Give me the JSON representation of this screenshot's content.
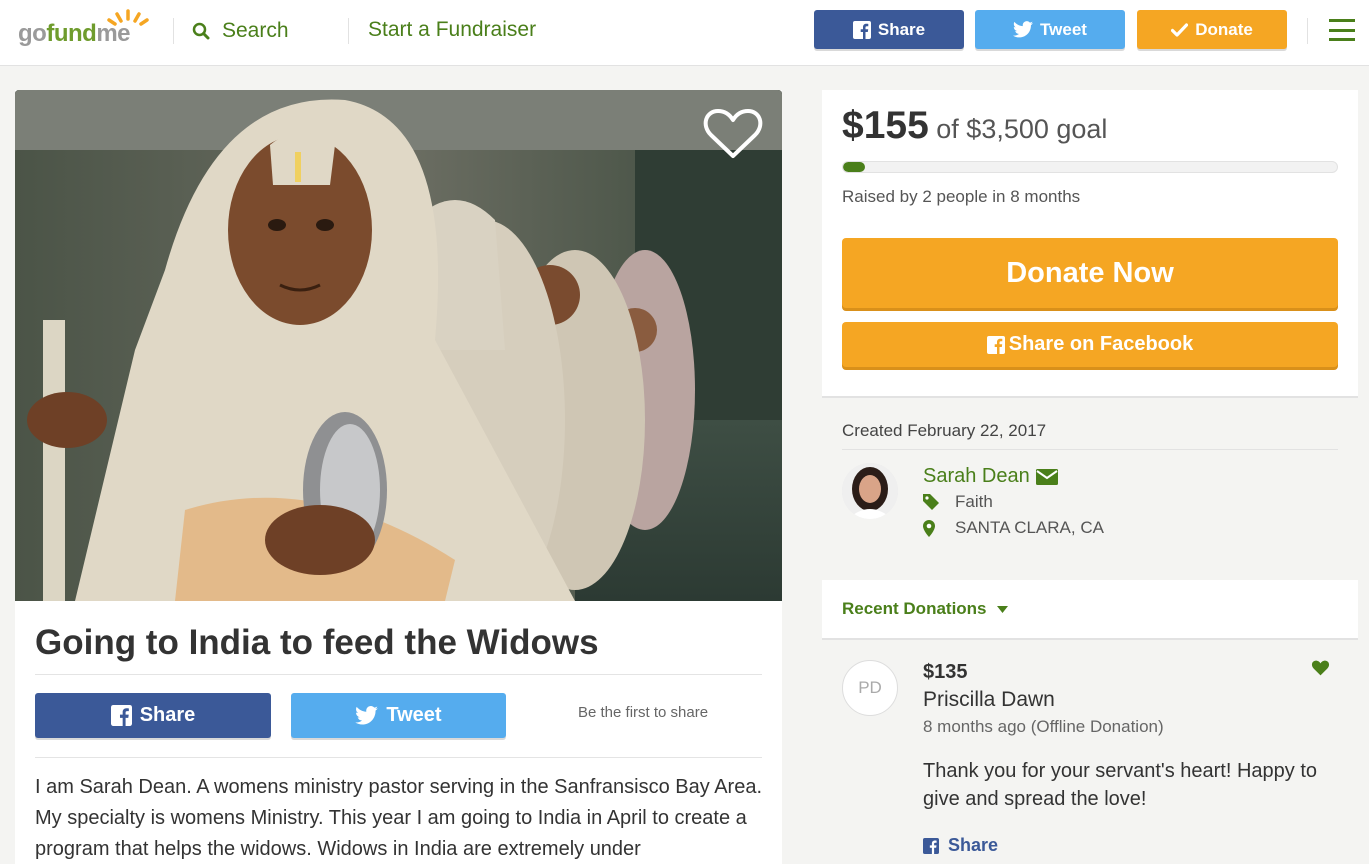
{
  "header": {
    "logo": "gofundme",
    "search_label": "Search",
    "start_label": "Start a Fundraiser",
    "share_label": "Share",
    "tweet_label": "Tweet",
    "donate_label": "Donate"
  },
  "campaign": {
    "title": "Going to India to feed the Widows",
    "share_label": "Share",
    "tweet_label": "Tweet",
    "first_share_text": "Be the first to share",
    "story": "I am Sarah Dean. A womens ministry pastor serving in the Sanfransisco Bay Area. My specialty is womens Ministry.  This year I am going to India in April to create a program that helps the widows. Widows in India are extremely under"
  },
  "goal": {
    "raised_amount": "$155",
    "goal_text": "of $3,500 goal",
    "progress_fraction": 0.044,
    "raised_by": "Raised by 2 people in 8 months",
    "donate_now_label": "Donate Now",
    "share_facebook_label": "Share on Facebook"
  },
  "organizer": {
    "created": "Created February 22, 2017",
    "name": "Sarah Dean",
    "category": "Faith",
    "location": "SANTA CLARA, CA"
  },
  "recent_donations": {
    "label": "Recent Donations",
    "items": [
      {
        "initials": "PD",
        "amount": "$135",
        "name": "Priscilla Dawn",
        "time": "8 months ago (Offline Donation)",
        "message": "Thank you for your servant's heart! Happy to give and spread the love!",
        "share_label": "Share"
      }
    ]
  },
  "colors": {
    "brand_green": "#4a7f1a",
    "facebook": "#3b5998",
    "twitter": "#55acee",
    "donate_orange": "#f5a623"
  }
}
